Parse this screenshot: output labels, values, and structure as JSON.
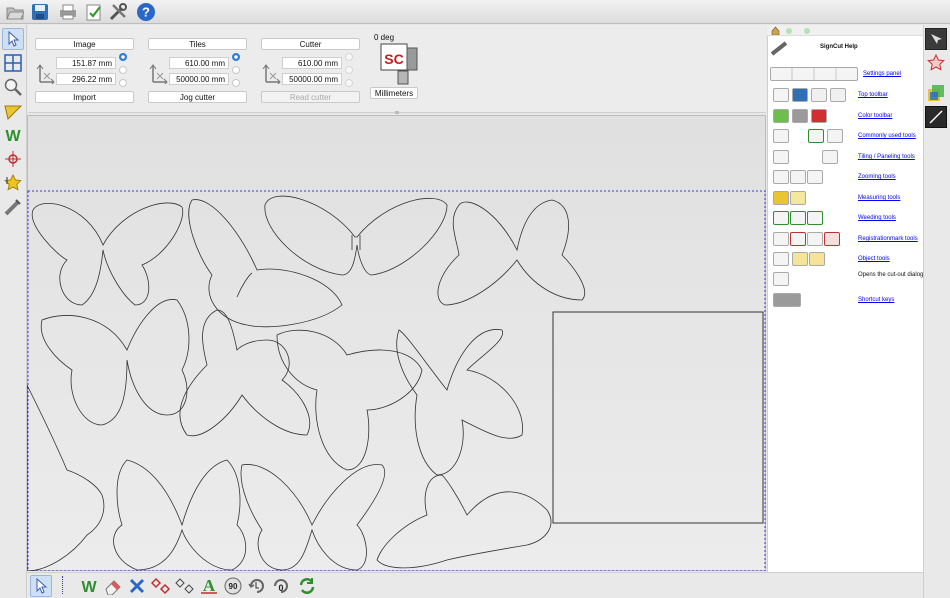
{
  "panels": {
    "image": {
      "title": "Image",
      "width": "151.87 mm",
      "height": "296.22 mm",
      "action": "Import"
    },
    "tiles": {
      "title": "Tiles",
      "width": "610.00 mm",
      "height": "50000.00 mm",
      "action": "Jog cutter"
    },
    "cutter": {
      "title": "Cutter",
      "width": "610.00 mm",
      "height": "50000.00 mm",
      "action": "Read cutter"
    },
    "rotation": "0 deg",
    "logo": "SC",
    "units": "Millimeters"
  },
  "help": {
    "title": "SignCut Help",
    "items": [
      {
        "label": "Settings panel"
      },
      {
        "label": "Top toolbar"
      },
      {
        "label": "Color toolbar"
      },
      {
        "label": "Commonly used tools"
      },
      {
        "label": "Tiling / Paneling tools"
      },
      {
        "label": "Zooming tools"
      },
      {
        "label": "Measuring tools"
      },
      {
        "label": "Weeding tools"
      },
      {
        "label": "Registrationmark tools"
      },
      {
        "label": "Object tools"
      },
      {
        "label": "Opens the cut-out dialog"
      },
      {
        "label": "Shortcut keys"
      }
    ]
  },
  "toolbar": {
    "top_icons": [
      "open-folder-icon",
      "save-icon",
      "print-icon",
      "checklist-icon",
      "tools-icon",
      "help-icon"
    ],
    "left_icons": [
      "pointer-icon",
      "tiling-icon",
      "zoom-icon",
      "measure-icon",
      "weed-icon",
      "regmark-icon",
      "object-star-icon",
      "cutter-knife-icon"
    ],
    "bottom_icons": [
      "pointer-icon",
      "weed-icon",
      "eraser-icon",
      "cross-icon",
      "regmark-icon",
      "nodes-icon",
      "text-icon",
      "rotate-90-icon",
      "rotate-icon",
      "rotate-0-icon",
      "refresh-icon"
    ],
    "bottom_labels": {
      "rotate90": "90",
      "rotate0": "0"
    }
  },
  "colors": {
    "accent": "#2a7de1",
    "link": "#0000ee",
    "canvas": "#e6e6e6",
    "selection": "#3b3bd0"
  }
}
